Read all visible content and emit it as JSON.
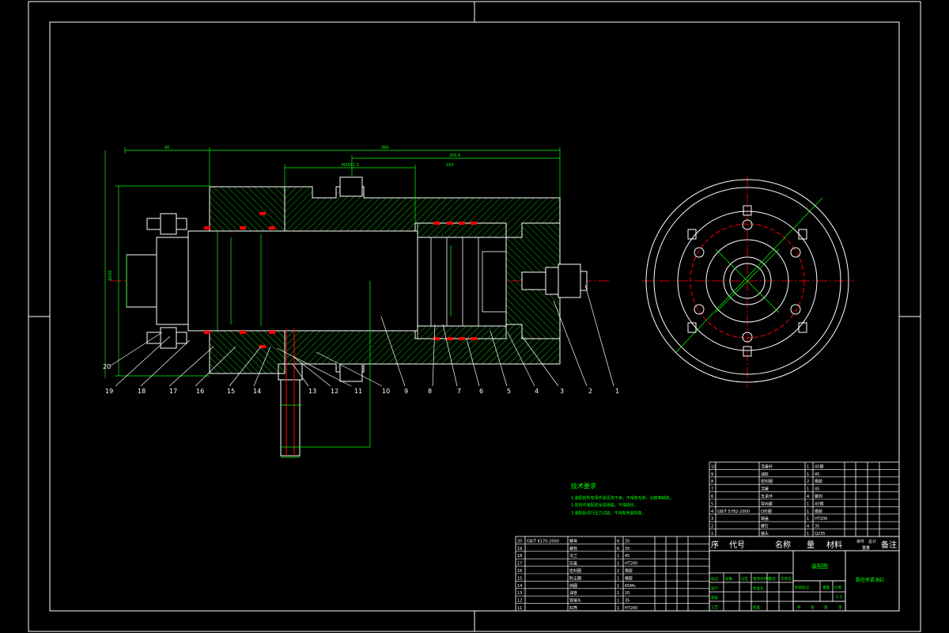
{
  "drawing": {
    "colors": {
      "background": "#000000",
      "outline": "#ffffff",
      "dimension": "#00ff00",
      "hatch": "#00ff00",
      "centerline": "#ff0000",
      "seal": "#ff0000"
    },
    "part_numbers": [
      "1",
      "2",
      "3",
      "4",
      "5",
      "6",
      "7",
      "8",
      "9",
      "10",
      "11",
      "12",
      "13",
      "14",
      "15",
      "16",
      "17",
      "18",
      "19",
      "20"
    ],
    "tech_req": {
      "title": "技术要求",
      "lines": [
        "1.装配前所有零件需清洗干净，不得有毛刺、划痕等缺陷。",
        "2.密封件装配前涂润滑脂，不得损伤。",
        "3.装配后进行压力试验，不得有泄漏现象。"
      ]
    },
    "title_block": {
      "header": {
        "seq": "序",
        "code": "代号",
        "name": "名称",
        "qty": "量",
        "material": "材料",
        "single": "单件",
        "total": "总计",
        "weight": "重量",
        "remark": "备注"
      },
      "drawing_name": "装配图",
      "product_name": "数控夹紧油缸",
      "scale": "1:1",
      "bom_upper": [
        {
          "no": "10",
          "name": "活塞杆",
          "qty": "1",
          "mat": "45钢"
        },
        {
          "no": "9",
          "name": "油缸",
          "qty": "1",
          "mat": "45"
        },
        {
          "no": "8",
          "name": "密封圈",
          "qty": "2",
          "mat": "橡胶"
        },
        {
          "no": "7",
          "name": "活塞",
          "qty": "1",
          "mat": "45"
        },
        {
          "no": "6",
          "name": "支承环",
          "qty": "4",
          "mat": "聚四"
        },
        {
          "no": "5",
          "name": "导向套",
          "qty": "1",
          "mat": "45钢"
        },
        {
          "no": "4",
          "name": "O形圈",
          "qty": "1",
          "mat": "橡胶"
        },
        {
          "no": "3",
          "name": "端盖",
          "qty": "1",
          "mat": "HT200"
        },
        {
          "no": "2",
          "name": "螺钉",
          "qty": "4",
          "mat": "35"
        },
        {
          "no": "1",
          "name": "接头",
          "qty": "1",
          "mat": "Q235"
        }
      ],
      "bom_upper_codes": [
        "",
        "",
        "",
        "",
        "",
        "",
        "GB/T 5782-2000",
        "",
        "",
        ""
      ],
      "bom_lower": [
        {
          "no": "20",
          "code": "GB/T 6170-2000",
          "name": "螺母",
          "qty": "6",
          "mat": "35"
        },
        {
          "no": "19",
          "code": "",
          "name": "螺栓",
          "qty": "6",
          "mat": "35"
        },
        {
          "no": "18",
          "code": "",
          "name": "法兰",
          "qty": "1",
          "mat": "45"
        },
        {
          "no": "17",
          "code": "",
          "name": "压盖",
          "qty": "1",
          "mat": "HT200"
        },
        {
          "no": "16",
          "code": "",
          "name": "密封圈",
          "qty": "2",
          "mat": "橡胶"
        },
        {
          "no": "15",
          "code": "",
          "name": "防尘圈",
          "qty": "1",
          "mat": "橡胶"
        },
        {
          "no": "14",
          "code": "",
          "name": "挡圈",
          "qty": "1",
          "mat": "65Mn"
        },
        {
          "no": "13",
          "code": "",
          "name": "油管",
          "qty": "1",
          "mat": "20"
        },
        {
          "no": "12",
          "code": "",
          "name": "管接头",
          "qty": "1",
          "mat": "35"
        },
        {
          "no": "11",
          "code": "",
          "name": "缸筒",
          "qty": "1",
          "mat": "HT200"
        }
      ],
      "sign_labels": [
        "标记",
        "处数",
        "分区",
        "更改文件号",
        "签名",
        "年月日"
      ],
      "role_labels": [
        "设计",
        "审核",
        "工艺",
        "批准",
        "标准化"
      ],
      "stage_labels": [
        "阶段标记",
        "重量",
        "比例"
      ],
      "sheet_labels": [
        "共",
        "张",
        "第",
        "张"
      ]
    }
  }
}
